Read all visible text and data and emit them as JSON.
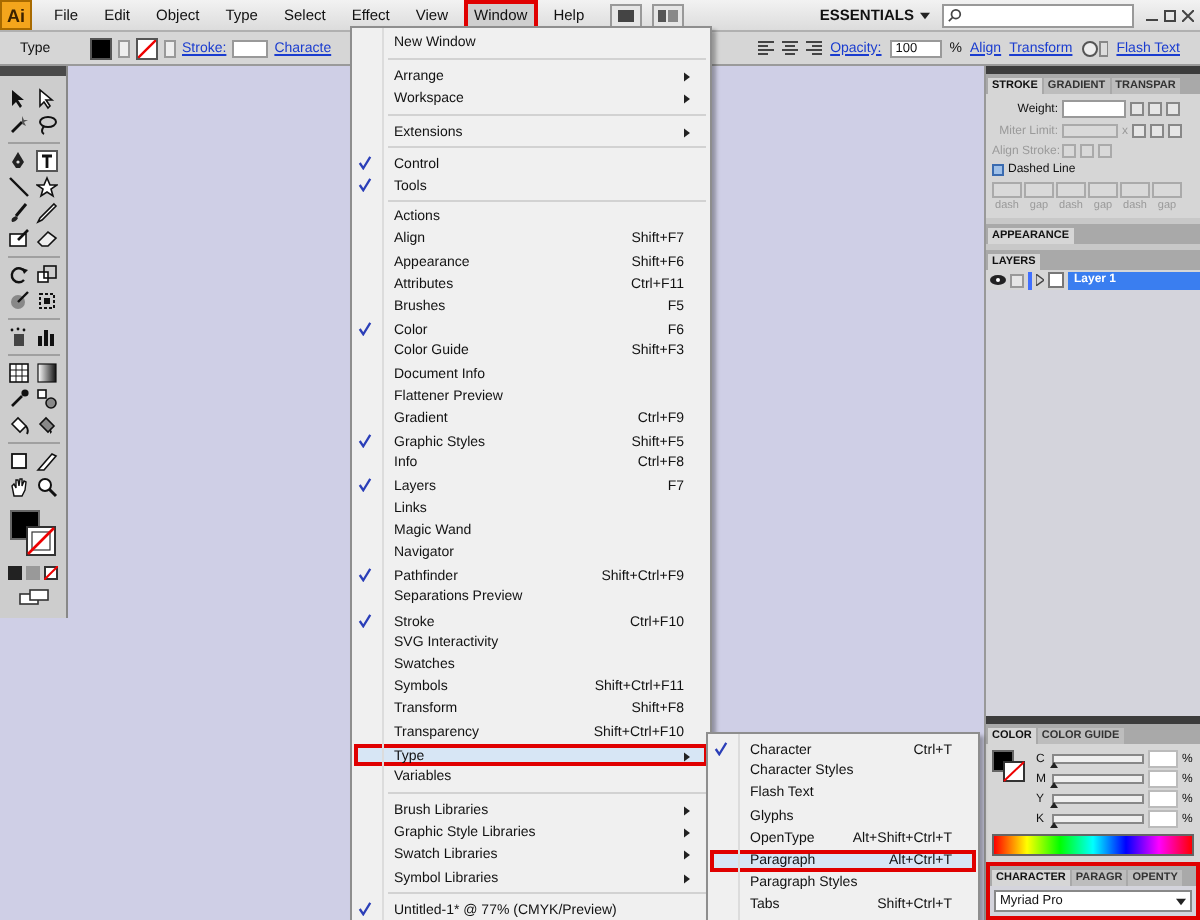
{
  "menu_bar": {
    "logo": "Ai",
    "items": [
      {
        "label": "File",
        "selected": false
      },
      {
        "label": "Edit",
        "selected": false
      },
      {
        "label": "Object",
        "selected": false
      },
      {
        "label": "Type",
        "selected": false
      },
      {
        "label": "Select",
        "selected": false
      },
      {
        "label": "Effect",
        "selected": false
      },
      {
        "label": "View",
        "selected": false
      },
      {
        "label": "Window",
        "selected": true
      },
      {
        "label": "Help",
        "selected": false
      }
    ],
    "workspace": "ESSENTIALS"
  },
  "control_bar": {
    "tool": "Type",
    "stroke_label": "Stroke:",
    "character_link": "Characte",
    "opacity_label": "Opacity:",
    "opacity_value": "100",
    "opacity_unit": "%",
    "links": [
      "Align",
      "Transform"
    ],
    "flash_text": "Flash Text"
  },
  "window_menu": {
    "groups": [
      {
        "items": [
          {
            "label": "New Window",
            "checked": false,
            "selected": false,
            "submenu": false
          }
        ]
      },
      {
        "items": [
          {
            "label": "Arrange",
            "checked": false,
            "selected": false,
            "submenu": true
          },
          {
            "label": "Workspace",
            "checked": false,
            "selected": false,
            "submenu": true
          }
        ]
      },
      {
        "items": [
          {
            "label": "Extensions",
            "checked": false,
            "selected": false,
            "submenu": true
          }
        ]
      },
      {
        "items": [
          {
            "label": "Control",
            "checked": true,
            "selected": false,
            "submenu": false
          },
          {
            "label": "Tools",
            "checked": true,
            "selected": false,
            "submenu": false
          }
        ]
      },
      {
        "items": [
          {
            "label": "Actions",
            "checked": false,
            "selected": false,
            "submenu": false
          },
          {
            "label": "Align",
            "shortcut": "Shift+F7",
            "checked": false,
            "selected": false,
            "submenu": false
          },
          {
            "label": "Appearance",
            "shortcut": "Shift+F6",
            "checked": false,
            "selected": false,
            "submenu": false
          },
          {
            "label": "Attributes",
            "shortcut": "Ctrl+F11",
            "checked": false,
            "selected": false,
            "submenu": false
          },
          {
            "label": "Brushes",
            "shortcut": "F5",
            "checked": false,
            "selected": false,
            "submenu": false
          },
          {
            "label": "Color",
            "shortcut": "F6",
            "checked": true,
            "selected": false,
            "submenu": false
          },
          {
            "label": "Color Guide",
            "shortcut": "Shift+F3",
            "checked": false,
            "selected": false,
            "submenu": false
          },
          {
            "label": "Document Info",
            "checked": false,
            "selected": false,
            "submenu": false
          },
          {
            "label": "Flattener Preview",
            "checked": false,
            "selected": false,
            "submenu": false
          },
          {
            "label": "Gradient",
            "shortcut": "Ctrl+F9",
            "checked": false,
            "selected": false,
            "submenu": false
          },
          {
            "label": "Graphic Styles",
            "shortcut": "Shift+F5",
            "checked": true,
            "selected": false,
            "submenu": false
          },
          {
            "label": "Info",
            "shortcut": "Ctrl+F8",
            "checked": false,
            "selected": false,
            "submenu": false
          },
          {
            "label": "Layers",
            "shortcut": "F7",
            "checked": true,
            "selected": false,
            "submenu": false
          },
          {
            "label": "Links",
            "checked": false,
            "selected": false,
            "submenu": false
          },
          {
            "label": "Magic Wand",
            "checked": false,
            "selected": false,
            "submenu": false
          },
          {
            "label": "Navigator",
            "checked": false,
            "selected": false,
            "submenu": false
          },
          {
            "label": "Pathfinder",
            "shortcut": "Shift+Ctrl+F9",
            "checked": true,
            "selected": false,
            "submenu": false
          },
          {
            "label": "Separations Preview",
            "checked": false,
            "selected": false,
            "submenu": false
          },
          {
            "label": "Stroke",
            "shortcut": "Ctrl+F10",
            "checked": true,
            "selected": false,
            "submenu": false
          },
          {
            "label": "SVG Interactivity",
            "checked": false,
            "selected": false,
            "submenu": false
          },
          {
            "label": "Swatches",
            "checked": false,
            "selected": false,
            "submenu": false
          },
          {
            "label": "Symbols",
            "shortcut": "Shift+Ctrl+F11",
            "checked": false,
            "selected": false,
            "submenu": false
          },
          {
            "label": "Transform",
            "shortcut": "Shift+F8",
            "checked": false,
            "selected": false,
            "submenu": false
          },
          {
            "label": "Transparency",
            "shortcut": "Shift+Ctrl+F10",
            "checked": false,
            "selected": false,
            "submenu": false
          },
          {
            "label": "Type",
            "checked": false,
            "selected": true,
            "submenu": true
          },
          {
            "label": "Variables",
            "checked": false,
            "selected": false,
            "submenu": false
          }
        ]
      },
      {
        "items": [
          {
            "label": "Brush Libraries",
            "checked": false,
            "selected": false,
            "submenu": true
          },
          {
            "label": "Graphic Style Libraries",
            "checked": false,
            "selected": false,
            "submenu": true
          },
          {
            "label": "Swatch Libraries",
            "checked": false,
            "selected": false,
            "submenu": true
          },
          {
            "label": "Symbol Libraries",
            "checked": false,
            "selected": false,
            "submenu": true
          }
        ]
      },
      {
        "items": [
          {
            "label": "Untitled-1* @ 77% (CMYK/Preview)",
            "checked": true,
            "selected": false,
            "submenu": false
          }
        ]
      }
    ]
  },
  "type_submenu": {
    "items": [
      {
        "label": "Character",
        "shortcut": "Ctrl+T",
        "checked": true,
        "selected": false
      },
      {
        "label": "Character Styles",
        "checked": false,
        "selected": false
      },
      {
        "label": "Flash Text",
        "checked": false,
        "selected": false
      },
      {
        "label": "Glyphs",
        "checked": false,
        "selected": false
      },
      {
        "label": "OpenType",
        "shortcut": "Alt+Shift+Ctrl+T",
        "checked": false,
        "selected": false
      },
      {
        "label": "Paragraph",
        "shortcut": "Alt+Ctrl+T",
        "checked": false,
        "selected": true
      },
      {
        "label": "Paragraph Styles",
        "checked": false,
        "selected": false
      },
      {
        "label": "Tabs",
        "shortcut": "Shift+Ctrl+T",
        "checked": false,
        "selected": false
      }
    ]
  },
  "stroke_panel": {
    "tabs": [
      {
        "label": "STROKE",
        "selected": true
      },
      {
        "label": "GRADIENT",
        "selected": false
      },
      {
        "label": "TRANSPAR",
        "selected": false
      }
    ],
    "weight_label": "Weight:",
    "miter": {
      "label": "Miter Limit:",
      "unit": "x",
      "disabled": true
    },
    "align_stroke": {
      "label": "Align Stroke:",
      "disabled": true
    },
    "dashed": {
      "label": "Dashed Line",
      "checked": false,
      "fields_disabled": true,
      "field_labels": [
        "dash",
        "gap",
        "dash",
        "gap",
        "dash",
        "gap"
      ]
    }
  },
  "appearance_panel": {
    "tab": "APPEARANCE"
  },
  "layers_panel": {
    "tab": "LAYERS",
    "layers": [
      {
        "name": "Layer 1",
        "selected": true,
        "visible": true,
        "color": "#3f6fff"
      }
    ]
  },
  "color_panel": {
    "tabs": [
      {
        "label": "COLOR",
        "selected": true
      },
      {
        "label": "COLOR GUIDE",
        "selected": false
      }
    ],
    "channels": [
      {
        "label": "C",
        "unit": "%",
        "level": 0
      },
      {
        "label": "M",
        "unit": "%",
        "level": 0
      },
      {
        "label": "Y",
        "unit": "%",
        "level": 0
      },
      {
        "label": "K",
        "unit": "%",
        "level": 0
      }
    ]
  },
  "character_panel": {
    "highlighted": true,
    "tabs": [
      {
        "label": "CHARACTER",
        "selected": true
      },
      {
        "label": "PARAGR",
        "selected": false
      },
      {
        "label": "OPENTY",
        "selected": false
      }
    ],
    "font": "Myriad Pro"
  }
}
